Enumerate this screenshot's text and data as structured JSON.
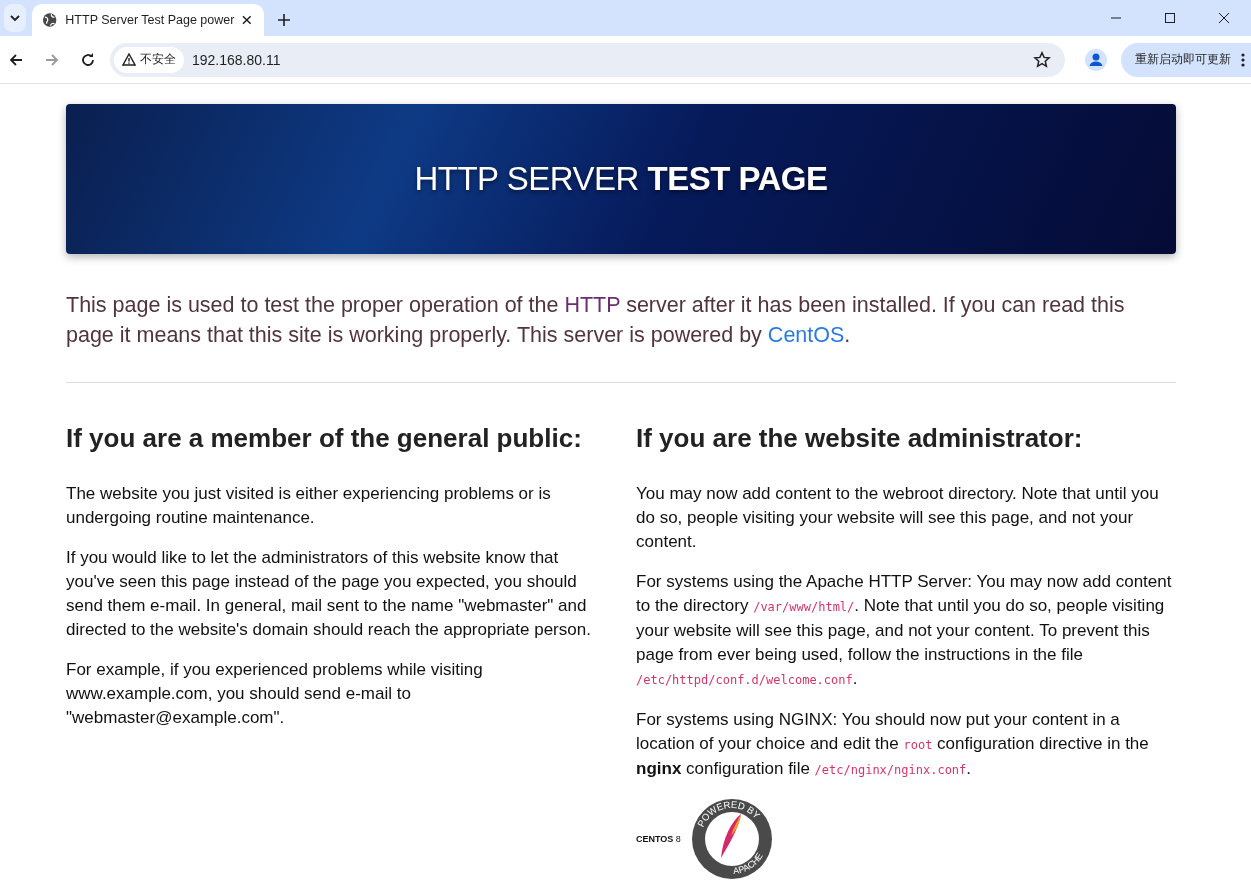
{
  "browser": {
    "tab": {
      "title": "HTTP Server Test Page power",
      "selected": true
    },
    "address": {
      "security": "不安全",
      "url": "192.168.80.11"
    },
    "update_button": "重新启动即可更新"
  },
  "banner": {
    "title": "HTTP SERVER **TEST PAGE**"
  },
  "intro": [
    {
      "kind": "text",
      "text": "This page is used to test the proper operation of the "
    },
    {
      "kind": "link",
      "text": "HTTP",
      "visited": true
    },
    {
      "kind": "text",
      "text": " server after it has been installed. If you can read this page it means that this site is working properly. This server is powered by "
    },
    {
      "kind": "link",
      "text": "CentOS",
      "visited": false
    },
    {
      "kind": "text",
      "text": "."
    }
  ],
  "columns": [
    {
      "heading": "If you are a member of the general public:",
      "paragraphs": [
        [
          {
            "kind": "text",
            "text": "The website you just visited is either experiencing problems or is undergoing routine maintenance."
          }
        ],
        [
          {
            "kind": "text",
            "text": "If you would like to let the administrators of this website know that you've seen this page instead of the page you expected, you should send them e-mail. In general, mail sent to the name \"webmaster\" and directed to the website's domain should reach the appropriate person."
          }
        ],
        [
          {
            "kind": "text",
            "text": "For example, if you experienced problems while visiting www.example.com, you should send e-mail to \"webmaster@example.com\"."
          }
        ]
      ]
    },
    {
      "heading": "If you are the website administrator:",
      "paragraphs": [
        [
          {
            "kind": "text",
            "text": "You may now add content to the webroot directory. Note that until you do so, people visiting your website will see this page, and not your content."
          }
        ],
        [
          {
            "kind": "text",
            "text": "For systems using the Apache HTTP Server: You may now add content to the directory "
          },
          {
            "kind": "code",
            "text": "/var/www/html/"
          },
          {
            "kind": "text",
            "text": ". Note that until you do so, people visiting your website will see this page, and not your content. To prevent this page from ever being used, follow the instructions in the file "
          },
          {
            "kind": "code",
            "text": "/etc/httpd/conf.d/welcome.conf"
          },
          {
            "kind": "text",
            "text": "."
          }
        ],
        [
          {
            "kind": "text",
            "text": "For systems using NGINX: You should now put your content in a location of your choice and edit the "
          },
          {
            "kind": "code",
            "text": "root"
          },
          {
            "kind": "text",
            "text": " configuration directive in the "
          },
          {
            "kind": "bold",
            "text": "nginx"
          },
          {
            "kind": "text",
            "text": " configuration file "
          },
          {
            "kind": "code",
            "text": "/etc/nginx/nginx.conf"
          },
          {
            "kind": "text",
            "text": "."
          }
        ]
      ]
    }
  ],
  "logos": {
    "centos": "**CENTOS** 8",
    "apache_top": "POWERED BY",
    "apache_bottom": "APACHE"
  }
}
